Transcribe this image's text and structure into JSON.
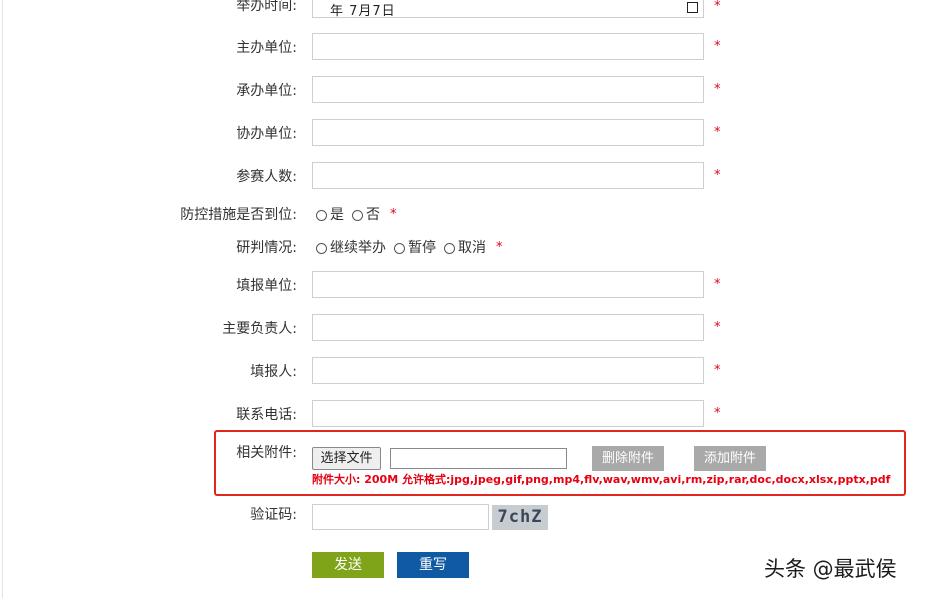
{
  "form": {
    "date": {
      "label": "举办时间:",
      "value": "年 7月7日",
      "required": "*"
    },
    "organizer": {
      "label": "主办单位:",
      "required": "*"
    },
    "undertaker": {
      "label": "承办单位:",
      "required": "*"
    },
    "co_organizer": {
      "label": "协办单位:",
      "required": "*"
    },
    "participants": {
      "label": "参赛人数:",
      "required": "*"
    },
    "prevention": {
      "label": "防控措施是否到位:",
      "options": [
        "是",
        "否"
      ],
      "required": "*"
    },
    "judgment": {
      "label": "研判情况:",
      "options": [
        "继续举办",
        "暂停",
        "取消"
      ],
      "required": "*"
    },
    "reporting_unit": {
      "label": "填报单位:",
      "required": "*"
    },
    "principal": {
      "label": "主要负责人:",
      "required": "*"
    },
    "reporter": {
      "label": "填报人:",
      "required": "*"
    },
    "phone": {
      "label": "联系电话:",
      "required": "*"
    },
    "attachment": {
      "label": "相关附件:",
      "choose_file": "选择文件",
      "delete_label": "删除附件",
      "add_label": "添加附件",
      "note": "附件大小: 200M 允许格式:jpg,jpeg,gif,png,mp4,flv,wav,wmv,avi,rm,zip,rar,doc,docx,xlsx,pptx,pdf"
    },
    "captcha": {
      "label": "验证码:",
      "image_text": "7chZ"
    },
    "submit_label": "发送",
    "reset_label": "重写"
  },
  "watermark": "头条 @最武侯",
  "colors": {
    "required": "#e60012",
    "highlight_border": "#e0261f",
    "send": "#7fa419",
    "reset": "#0f5aa2",
    "gray_button": "#a9a9a9"
  }
}
